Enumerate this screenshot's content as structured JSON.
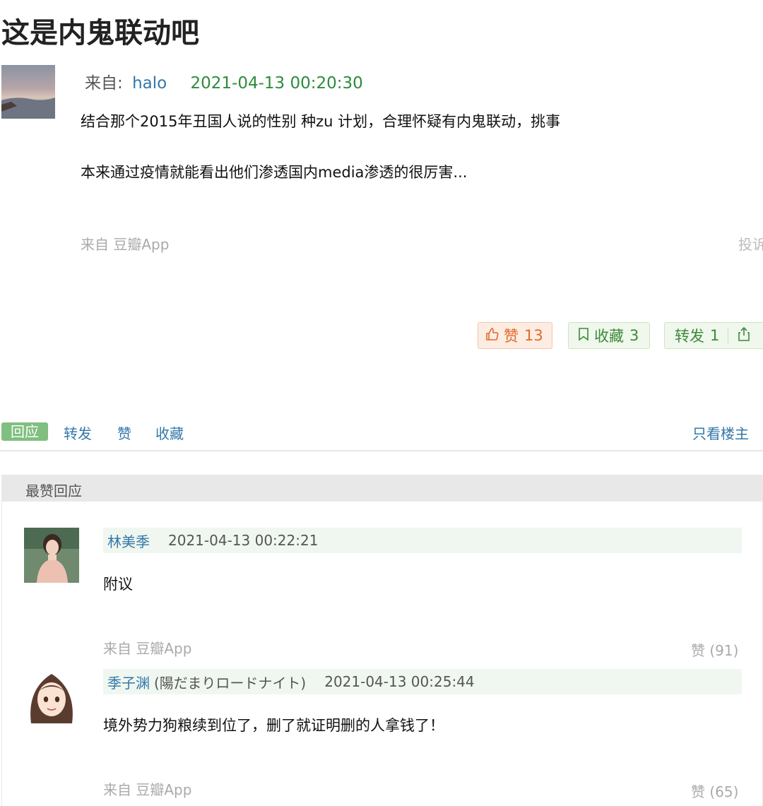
{
  "post": {
    "title": "这是内鬼联动吧",
    "from_label": "来自:",
    "author": "halo",
    "timestamp": "2021-04-13 00:20:30",
    "line1": "结合那个2015年丑国人说的性别 种zu 计划，合理怀疑有内鬼联动，挑事",
    "line2": "本来通过疫情就能看出他们渗透国内media渗透的很厉害...",
    "source": "来自 豆瓣App",
    "report": "投诉"
  },
  "actions": {
    "like_label": "赞",
    "like_count": "13",
    "collect_label": "收藏",
    "collect_count": "3",
    "share_label": "转发",
    "share_count": "1"
  },
  "tabs": {
    "reply": "回应",
    "forward": "转发",
    "like": "赞",
    "collect": "收藏",
    "only_op": "只看楼主"
  },
  "best_replies": {
    "label": "最赞回应",
    "comments": [
      {
        "name": "林美季",
        "nickname": "",
        "time": "2021-04-13 00:22:21",
        "text": "附议",
        "source": "来自 豆瓣App",
        "likes": "赞 (91)"
      },
      {
        "name": "季子渊",
        "nickname": "(陽だまりロードナイト)",
        "time": "2021-04-13 00:25:44",
        "text": "境外势力狗粮续到位了，删了就证明删的人拿钱了！",
        "source": "来自 豆瓣App",
        "likes": "赞 (65)"
      }
    ]
  },
  "colors": {
    "link": "#3377aa",
    "timestamp_green": "#2e8b3c",
    "like_orange": "#e06a2c",
    "action_green": "#3a8a3a",
    "tab_active": "#7fbf7f"
  },
  "icons": {
    "like": "thumbs-up-icon",
    "collect": "bookmark-icon",
    "share": "share-icon"
  }
}
